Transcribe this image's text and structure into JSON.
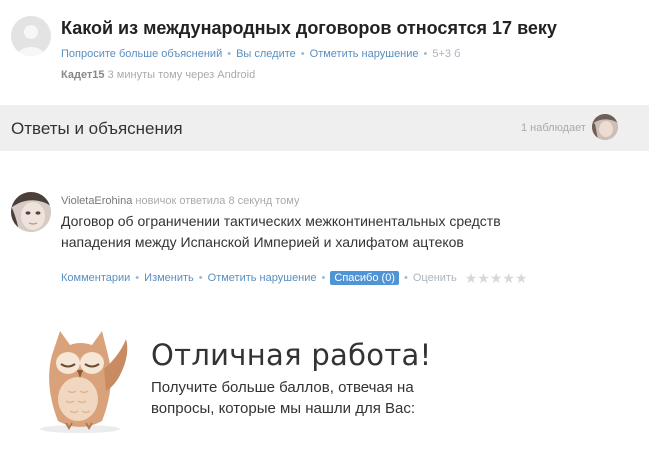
{
  "question": {
    "title": "Какой из международных договоров относятся 17 веку",
    "actions": {
      "more_explanations": "Попросите больше объяснений",
      "follow": "Вы следите",
      "report": "Отметить нарушение",
      "points": "5+3 б"
    },
    "author": "Кадет15",
    "time": "3 минуты тому через Android"
  },
  "answers_bar": {
    "title": "Ответы и объяснения",
    "watchers": "1 наблюдает"
  },
  "answer": {
    "user": "VioletaErohina",
    "status": "новичок ответила 8 секунд тому",
    "text": "Договор об ограничении тактических межконтинентальных средств нападения между Испанской Империей и халифатом ацтеков",
    "actions": {
      "comments": "Комментарии",
      "edit": "Изменить",
      "report": "Отметить нарушение",
      "thanks": "Спасибо (0)",
      "rate": "Оценить"
    },
    "rating": 0,
    "rating_max": 5
  },
  "promo": {
    "title": "Отличная работа!",
    "text": "Получите больше баллов, отвечая на вопросы, которые мы нашли для Вас:"
  },
  "colors": {
    "link": "#5a8ec0",
    "bar_bg": "#efefef",
    "button": "#4f95d6",
    "owl": "#d9a27a"
  }
}
